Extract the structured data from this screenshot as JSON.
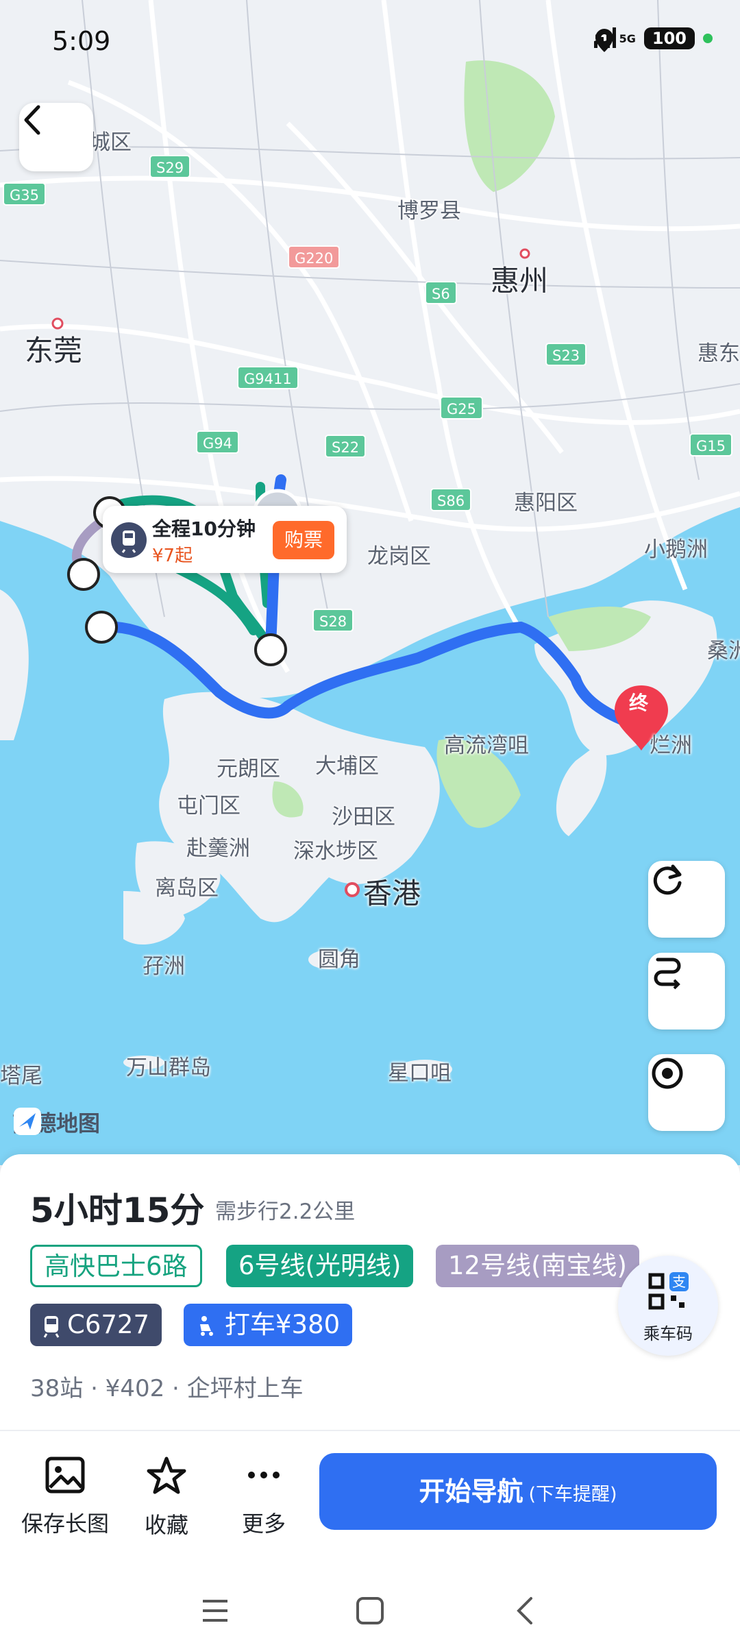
{
  "status_bar": {
    "time": "5:09",
    "signal1": "5G",
    "signal2": "5G",
    "battery": "100"
  },
  "map": {
    "labels": {
      "chengqu": "城区",
      "boluo": "博罗县",
      "huizhou": "惠州",
      "dongguan": "东莞",
      "huidong": "惠东",
      "huiyang": "惠阳区",
      "longgang": "龙岗区",
      "xiaopengzhou": "小鹅洲",
      "sang": "桑洲",
      "lanzhou": "烂洲",
      "gaoliuwanzui": "高流湾咀",
      "yuanlang": "元朗区",
      "dabu": "大埔区",
      "tunmen": "屯门区",
      "shatian": "沙田区",
      "lanzhou2": "赴羹洲",
      "shenshuibu": "深水埗区",
      "lidao": "离岛区",
      "xianggang": "香港",
      "zizhou": "孖洲",
      "yuanjiao": "圆角",
      "wanshan": "万山群岛",
      "xingkouzui": "星口咀",
      "tawei": "塔尾",
      "end_marker": "终"
    },
    "shields": [
      "S29",
      "G35",
      "G220",
      "S6",
      "G9411",
      "S23",
      "G25",
      "G94",
      "S22",
      "G15",
      "S86",
      "S28"
    ],
    "logo": "高德地图",
    "bubble": {
      "title": "全程10分钟",
      "price": "¥7起",
      "buy": "购票"
    }
  },
  "route": {
    "duration": "5小时15分",
    "walk": "需步行2.2公里",
    "chips": {
      "bus": "高快巴士6路",
      "line6": "6号线(光明线)",
      "line12": "12号线(南宝线)",
      "train": "C6727",
      "taxi": "打车¥380"
    },
    "summary": "38站 · ¥402 · 企坪村上车",
    "ride_code": "乘车码"
  },
  "actions": {
    "save": "保存长图",
    "favorite": "收藏",
    "more": "更多",
    "start_nav": "开始导航",
    "start_nav_sub": "(下车提醒)"
  },
  "colors": {
    "accent": "#2f6ff2",
    "route_blue": "#2f6ff2",
    "metro_green": "#15a383",
    "metro_purple": "#a79cc2",
    "sea": "#7fd3f5",
    "taxi_orange": "#ff6a2b"
  }
}
